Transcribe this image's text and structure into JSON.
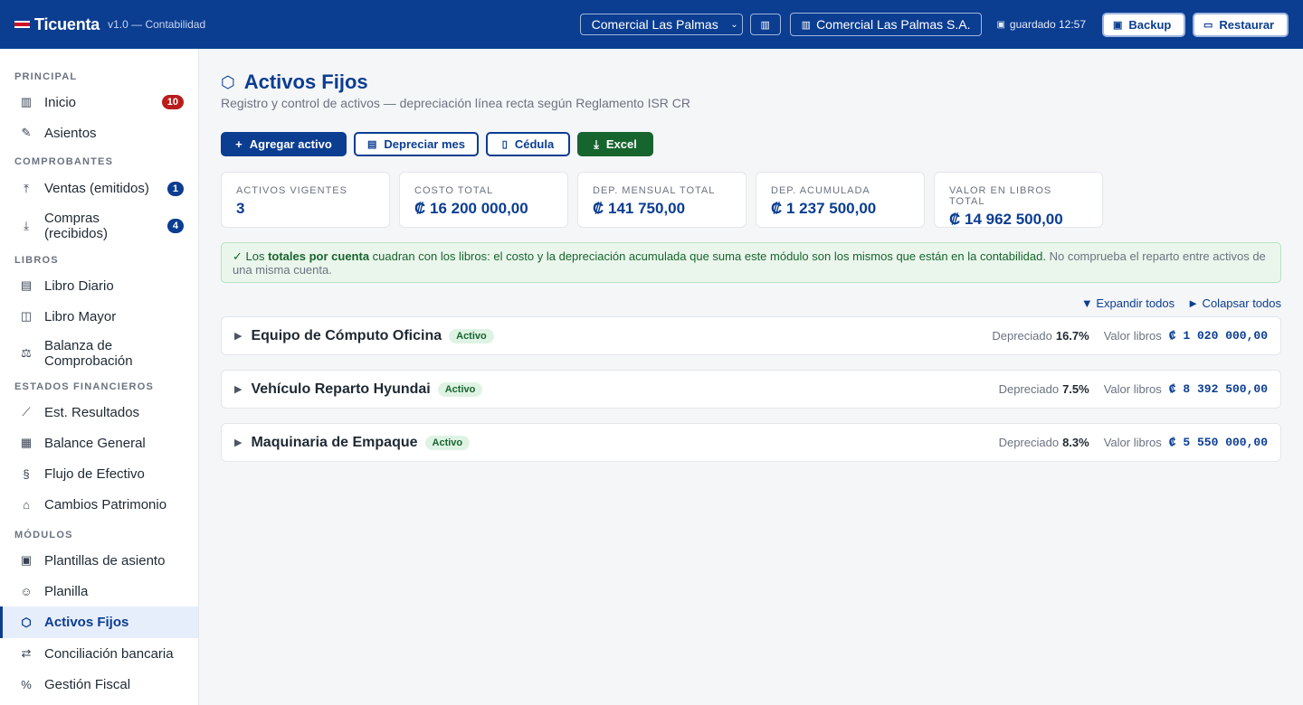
{
  "app": {
    "name": "Ticuenta",
    "version": "v1.0 — Contabilidad",
    "flag_colors": [
      "#0b3d91",
      "#ffffff",
      "#ce1126",
      "#ffffff",
      "#0b3d91"
    ]
  },
  "topbar": {
    "company_select": "Comercial Las Palmas S.A.",
    "company_chip": "Comercial Las Palmas S.A.",
    "saved": "guardado 12:57",
    "backup_label": "Backup",
    "restore_label": "Restaurar"
  },
  "sidebar": {
    "sections": [
      {
        "title": "PRINCIPAL",
        "items": [
          {
            "label": "Inicio",
            "icon": "bar-chart-icon",
            "glyph": "📊",
            "badge": "10",
            "badge_color": "red"
          },
          {
            "label": "Asientos",
            "icon": "pencil-icon",
            "glyph": "✎"
          }
        ]
      },
      {
        "title": "COMPROBANTES",
        "items": [
          {
            "label": "Ventas (emitidos)",
            "icon": "upload-icon",
            "glyph": "⤒",
            "badge": "1",
            "badge_color": "blue"
          },
          {
            "label": "Compras (recibidos)",
            "icon": "download-icon",
            "glyph": "⤓",
            "badge": "4",
            "badge_color": "blue"
          }
        ]
      },
      {
        "title": "LIBROS",
        "items": [
          {
            "label": "Libro Diario",
            "icon": "journal-icon",
            "glyph": "▤"
          },
          {
            "label": "Libro Mayor",
            "icon": "book-open-icon",
            "glyph": "📖"
          },
          {
            "label": "Balanza de Comprobación",
            "icon": "scale-icon",
            "glyph": "⚖"
          }
        ]
      },
      {
        "title": "ESTADOS FINANCIEROS",
        "items": [
          {
            "label": "Est. Resultados",
            "icon": "line-chart-icon",
            "glyph": "📈"
          },
          {
            "label": "Balance General",
            "icon": "table-icon",
            "glyph": "▦"
          },
          {
            "label": "Flujo de Efectivo",
            "icon": "cash-flow-icon",
            "glyph": "§"
          },
          {
            "label": "Cambios Patrimonio",
            "icon": "bank-icon",
            "glyph": "🏛"
          }
        ]
      },
      {
        "title": "MÓDULOS",
        "items": [
          {
            "label": "Plantillas de asiento",
            "icon": "template-icon",
            "glyph": "▣"
          },
          {
            "label": "Planilla",
            "icon": "users-icon",
            "glyph": "👥"
          },
          {
            "label": "Activos Fijos",
            "icon": "box-icon",
            "glyph": "⬡",
            "active": true
          },
          {
            "label": "Conciliación bancaria",
            "icon": "swap-icon",
            "glyph": "⇄"
          },
          {
            "label": "Gestión Fiscal",
            "icon": "percent-icon",
            "glyph": "%"
          }
        ]
      }
    ]
  },
  "page": {
    "title": "Activos Fijos",
    "subtitle": "Registro y control de activos — depreciación línea recta según Reglamento ISR CR",
    "actions": {
      "add": "Agregar activo",
      "depreciate": "Depreciar mes",
      "cedula": "Cédula",
      "excel": "Excel"
    },
    "kpis": [
      {
        "label": "ACTIVOS VIGENTES",
        "value": "3"
      },
      {
        "label": "COSTO TOTAL",
        "value": "₡ 16 200 000,00"
      },
      {
        "label": "DEP. MENSUAL TOTAL",
        "value": "₡ 141 750,00"
      },
      {
        "label": "DEP. ACUMULADA",
        "value": "₡ 1 237 500,00"
      },
      {
        "label": "VALOR EN LIBROS TOTAL",
        "value": "₡ 14 962 500,00"
      }
    ],
    "notice": {
      "p1": "✓ Los ",
      "p2": "totales por cuenta",
      "p3": " cuadran con los libros: el costo y la depreciación acumulada que suma este módulo son los mismos que están en la contabilidad.",
      "p4": " No comprueba el reparto entre activos de una misma cuenta."
    },
    "expand_all": "▼ Expandir todos",
    "collapse_all": "► Colapsar todos",
    "depreciated_label": "Depreciado",
    "book_label": "Valor libros",
    "assets": [
      {
        "name": "Equipo de Cómputo Oficina",
        "status": "Activo",
        "depreciated": "16.7%",
        "book_value": "₡ 1 020 000,00"
      },
      {
        "name": "Vehículo Reparto Hyundai",
        "status": "Activo",
        "depreciated": "7.5%",
        "book_value": "₡ 8 392 500,00"
      },
      {
        "name": "Maquinaria de Empaque",
        "status": "Activo",
        "depreciated": "8.3%",
        "book_value": "₡ 5 550 000,00"
      }
    ]
  }
}
